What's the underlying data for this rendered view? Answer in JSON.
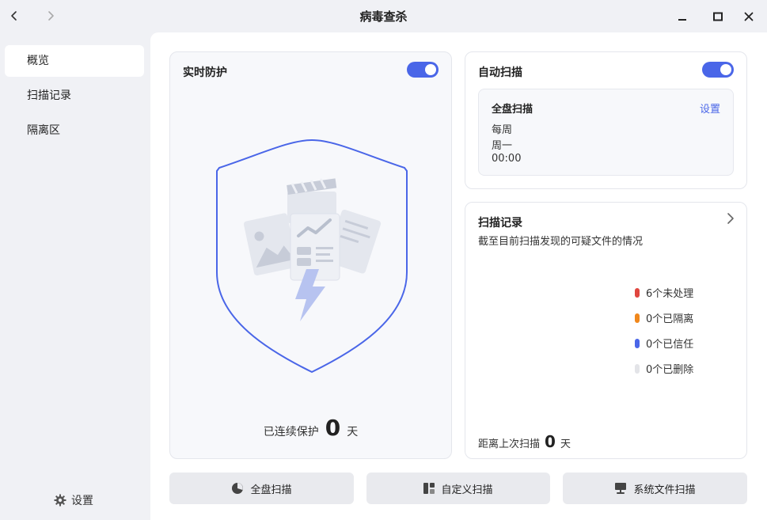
{
  "window": {
    "title": "病毒查杀"
  },
  "sidebar": {
    "items": [
      {
        "label": "概览",
        "active": true
      },
      {
        "label": "扫描记录",
        "active": false
      },
      {
        "label": "隔离区",
        "active": false
      }
    ],
    "settings_label": "设置"
  },
  "realtime": {
    "title": "实时防护",
    "enabled": true,
    "protect_prefix": "已连续保护",
    "protect_days": "0",
    "protect_suffix": "天"
  },
  "auto_scan": {
    "title": "自动扫描",
    "enabled": true,
    "box_title": "全盘扫描",
    "settings_link": "设置",
    "frequency": "每周",
    "day": "周一",
    "time": "00:00"
  },
  "records": {
    "title": "扫描记录",
    "subtitle": "截至目前扫描发现的可疑文件的情况",
    "legend": [
      {
        "label": "6个未处理",
        "color": "#e0463f"
      },
      {
        "label": "0个已隔离",
        "color": "#f0871c"
      },
      {
        "label": "0个已信任",
        "color": "#4a66e8"
      },
      {
        "label": "0个已删除",
        "color": "#e3e4e8"
      }
    ],
    "last_scan_prefix": "距离上次扫描",
    "last_scan_days": "0",
    "last_scan_suffix": "天"
  },
  "actions": {
    "full_scan": "全盘扫描",
    "custom_scan": "自定义扫描",
    "system_scan": "系统文件扫描"
  },
  "colors": {
    "accent": "#4a66e8"
  }
}
